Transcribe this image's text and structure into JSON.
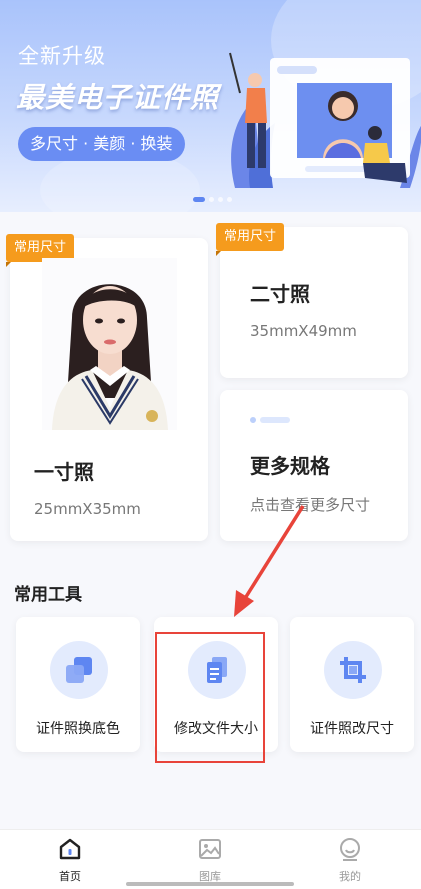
{
  "banner": {
    "subtitle": "全新升级",
    "title": "最美电子证件照",
    "features": "多尺寸 · 美颜 · 换装"
  },
  "cards": [
    {
      "tag": "常用尺寸",
      "title": "一寸照",
      "desc": "25mmX35mm"
    },
    {
      "tag": "常用尺寸",
      "title": "二寸照",
      "desc": "35mmX49mm"
    },
    {
      "title": "更多规格",
      "desc": "点击查看更多尺寸"
    }
  ],
  "tools": {
    "section_title": "常用工具",
    "items": [
      {
        "label": "证件照换底色",
        "icon": "layers-icon"
      },
      {
        "label": "修改文件大小",
        "icon": "file-copy-icon"
      },
      {
        "label": "证件照改尺寸",
        "icon": "crop-icon"
      }
    ]
  },
  "nav": {
    "items": [
      {
        "label": "首页",
        "icon": "home-icon"
      },
      {
        "label": "图库",
        "icon": "gallery-icon"
      },
      {
        "label": "我的",
        "icon": "profile-icon"
      }
    ]
  },
  "colors": {
    "accent": "#5e86f1",
    "tag": "#f59b1d",
    "highlight": "#e8443a"
  }
}
